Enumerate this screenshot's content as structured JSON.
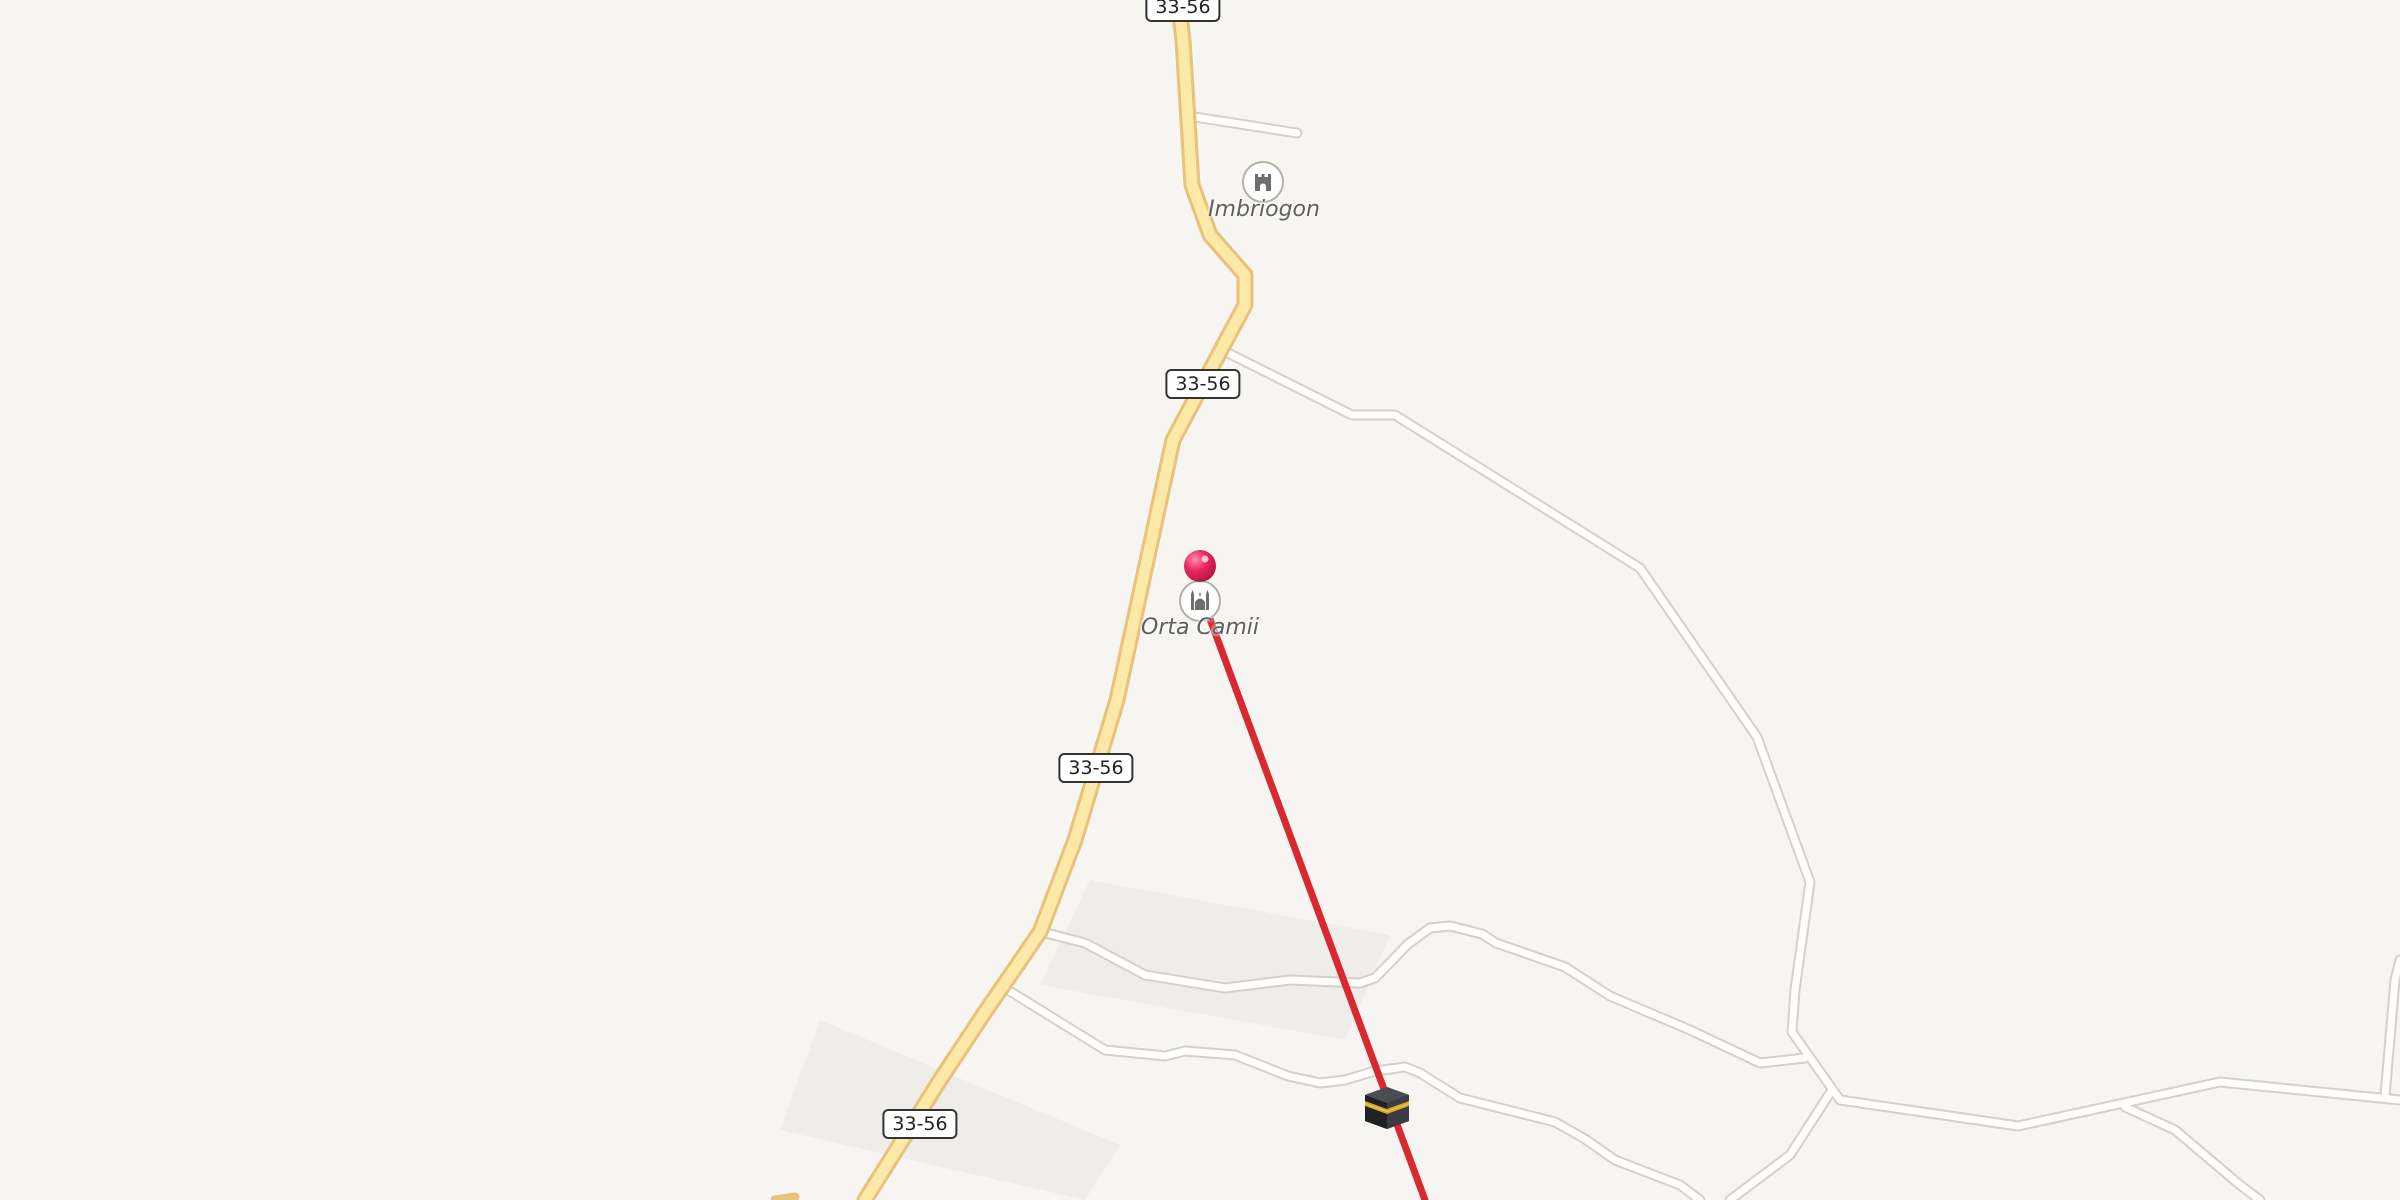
{
  "map": {
    "colors": {
      "background": "#f7f5f2",
      "primary_road_fill": "#fde9a7",
      "primary_road_casing": "#e8c27a",
      "minor_road_fill": "#ffffff",
      "minor_road_casing": "#d5d0ca",
      "landuse": "#efedea",
      "route_line": "#d9282f",
      "pin": "#e8215c"
    },
    "road_shields": [
      {
        "label": "33-56"
      },
      {
        "label": "33-56"
      },
      {
        "label": "33-56"
      },
      {
        "label": "33-56"
      }
    ],
    "pois": [
      {
        "label": "Imbriogon",
        "icon": "castle-icon"
      },
      {
        "label": "Orta Camii",
        "icon": "mosque-icon"
      }
    ],
    "markers": {
      "origin": "location-pin-icon",
      "destination": "kaaba-icon"
    }
  }
}
